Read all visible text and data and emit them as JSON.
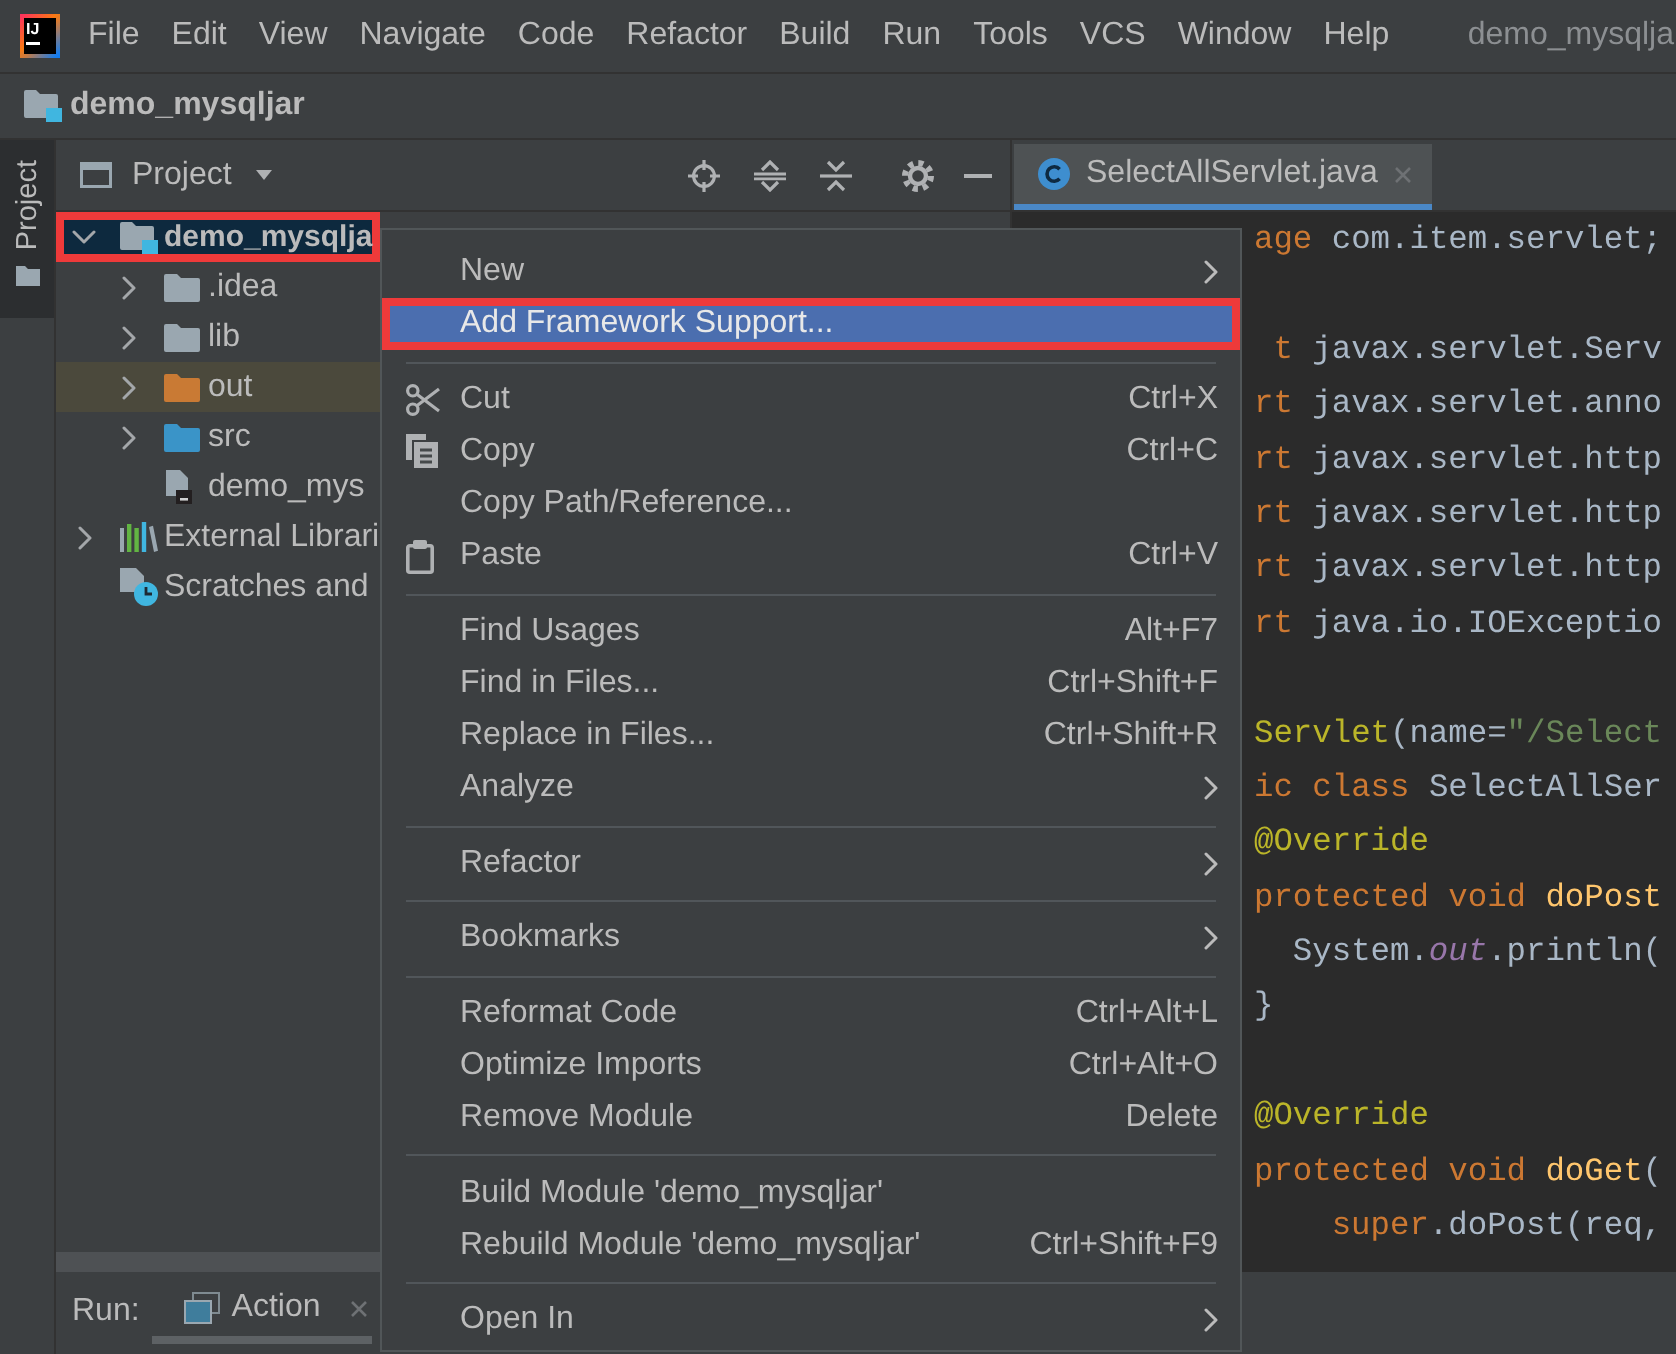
{
  "app_logo": {
    "text": "IJ"
  },
  "menu_bar": {
    "items": [
      {
        "label": "File"
      },
      {
        "label": "Edit"
      },
      {
        "label": "View"
      },
      {
        "label": "Navigate"
      },
      {
        "label": "Code"
      },
      {
        "label": "Refactor"
      },
      {
        "label": "Build"
      },
      {
        "label": "Run"
      },
      {
        "label": "Tools"
      },
      {
        "label": "VCS"
      },
      {
        "label": "Window"
      },
      {
        "label": "Help"
      }
    ],
    "window_title": "demo_mysqlja"
  },
  "navigation_bar": {
    "breadcrumbs": [
      {
        "label": "demo_mysqljar"
      }
    ]
  },
  "tool_strip": {
    "tabs": [
      {
        "label": "Project",
        "selected": true
      }
    ]
  },
  "project_panel": {
    "title": "Project",
    "tree": [
      {
        "label": "demo_mysqlja",
        "kind": "module",
        "selected": true,
        "highlighted": true,
        "expanded": true,
        "children": [
          {
            "label": ".idea",
            "kind": "folder",
            "selected": false,
            "highlighted": false,
            "expanded": false
          },
          {
            "label": "lib",
            "kind": "folder",
            "selected": false,
            "highlighted": false,
            "expanded": false
          },
          {
            "label": "out",
            "kind": "excluded",
            "selected": false,
            "highlighted": false,
            "expanded": false
          },
          {
            "label": "src",
            "kind": "source",
            "selected": false,
            "highlighted": false,
            "expanded": false
          },
          {
            "label": "demo_mys",
            "kind": "file",
            "selected": false,
            "highlighted": false
          }
        ]
      },
      {
        "label": "External Librari",
        "kind": "libraries",
        "selected": false,
        "highlighted": false,
        "expanded": false
      },
      {
        "label": "Scratches and",
        "kind": "scratches",
        "selected": false,
        "highlighted": false
      }
    ]
  },
  "editor": {
    "tabs": [
      {
        "label": "SelectAllServlet.java",
        "selected": true
      }
    ],
    "blocks": [
      {
        "lines": [
          {
            "segments": [
              {
                "kind": "keyword",
                "text": "age"
              },
              {
                "kind": "plain",
                "text": " com.item.servlet;"
              }
            ]
          }
        ]
      },
      {
        "lines": [
          {
            "segments": [
              {
                "kind": "keyword",
                "text": "t"
              },
              {
                "kind": "plain",
                "text": " javax.servlet.Serv"
              }
            ]
          },
          {
            "segments": [
              {
                "kind": "keyword",
                "text": "rt"
              },
              {
                "kind": "plain",
                "text": " javax.servlet.anno"
              }
            ]
          },
          {
            "segments": [
              {
                "kind": "keyword",
                "text": "rt"
              },
              {
                "kind": "plain",
                "text": " javax.servlet.http"
              }
            ]
          },
          {
            "segments": [
              {
                "kind": "keyword",
                "text": "rt"
              },
              {
                "kind": "plain",
                "text": " javax.servlet.http"
              }
            ]
          },
          {
            "segments": [
              {
                "kind": "keyword",
                "text": "rt"
              },
              {
                "kind": "plain",
                "text": " javax.servlet.http"
              }
            ]
          },
          {
            "segments": [
              {
                "kind": "keyword",
                "text": "rt"
              },
              {
                "kind": "plain",
                "text": " java.io.IOExceptio"
              }
            ]
          }
        ]
      },
      {
        "lines": [
          {
            "segments": [
              {
                "kind": "annotation",
                "text": "Servlet"
              },
              {
                "kind": "plain",
                "text": "(name="
              },
              {
                "kind": "string",
                "text": "\"/Select"
              }
            ]
          },
          {
            "segments": [
              {
                "kind": "keyword",
                "text": "ic class "
              },
              {
                "kind": "plain",
                "text": "SelectAllSer"
              }
            ]
          },
          {
            "segments": [
              {
                "kind": "annotation",
                "text": "@Override"
              }
            ]
          },
          {
            "segments": [
              {
                "kind": "keyword",
                "text": "protected void "
              },
              {
                "kind": "method",
                "text": "doPost"
              }
            ]
          },
          {
            "segments": [
              {
                "kind": "plain",
                "text": "System."
              },
              {
                "kind": "field",
                "text": "out"
              },
              {
                "kind": "plain",
                "text": ".println("
              }
            ]
          },
          {
            "segments": [
              {
                "kind": "plain",
                "text": "}"
              }
            ]
          }
        ]
      },
      {
        "lines": [
          {
            "segments": [
              {
                "kind": "annotation",
                "text": "@Override"
              }
            ]
          },
          {
            "segments": [
              {
                "kind": "keyword",
                "text": "protected void "
              },
              {
                "kind": "method",
                "text": "doGet"
              },
              {
                "kind": "plain",
                "text": "("
              }
            ]
          },
          {
            "segments": [
              {
                "kind": "keyword",
                "text": "super"
              },
              {
                "kind": "plain",
                "text": ".doPost(req,"
              }
            ]
          }
        ]
      }
    ]
  },
  "run_panel": {
    "label": "Run:",
    "tabs": [
      {
        "label": "Action",
        "selected": true
      }
    ]
  },
  "context_menu": {
    "groups": [
      {
        "items": [
          {
            "label": "New",
            "submenu": true,
            "selected": false,
            "highlighted": false
          },
          {
            "label": "Add Framework Support...",
            "submenu": false,
            "selected": true,
            "highlighted": true
          }
        ]
      },
      {
        "items": [
          {
            "label": "Cut",
            "shortcut": "Ctrl+X",
            "submenu": false,
            "selected": false,
            "highlighted": false
          },
          {
            "label": "Copy",
            "shortcut": "Ctrl+C",
            "submenu": false,
            "selected": false,
            "highlighted": false
          },
          {
            "label": "Copy Path/Reference...",
            "submenu": false,
            "selected": false,
            "highlighted": false
          },
          {
            "label": "Paste",
            "shortcut": "Ctrl+V",
            "submenu": false,
            "selected": false,
            "highlighted": false
          }
        ]
      },
      {
        "items": [
          {
            "label": "Find Usages",
            "shortcut": "Alt+F7",
            "submenu": false,
            "selected": false,
            "highlighted": false
          },
          {
            "label": "Find in Files...",
            "shortcut": "Ctrl+Shift+F",
            "submenu": false,
            "selected": false,
            "highlighted": false
          },
          {
            "label": "Replace in Files...",
            "shortcut": "Ctrl+Shift+R",
            "submenu": false,
            "selected": false,
            "highlighted": false
          },
          {
            "label": "Analyze",
            "submenu": true,
            "selected": false,
            "highlighted": false
          }
        ]
      },
      {
        "items": [
          {
            "label": "Refactor",
            "submenu": true,
            "selected": false,
            "highlighted": false
          }
        ]
      },
      {
        "items": [
          {
            "label": "Bookmarks",
            "submenu": true,
            "selected": false,
            "highlighted": false
          }
        ]
      },
      {
        "items": [
          {
            "label": "Reformat Code",
            "shortcut": "Ctrl+Alt+L",
            "submenu": false,
            "selected": false,
            "highlighted": false
          },
          {
            "label": "Optimize Imports",
            "shortcut": "Ctrl+Alt+O",
            "submenu": false,
            "selected": false,
            "highlighted": false
          },
          {
            "label": "Remove Module",
            "shortcut": "Delete",
            "submenu": false,
            "selected": false,
            "highlighted": false
          }
        ]
      },
      {
        "items": [
          {
            "label": "Build Module 'demo_mysqljar'",
            "submenu": false,
            "selected": false,
            "highlighted": false
          },
          {
            "label": "Rebuild Module 'demo_mysqljar'",
            "shortcut": "Ctrl+Shift+F9",
            "submenu": false,
            "selected": false,
            "highlighted": false
          }
        ]
      },
      {
        "items": [
          {
            "label": "Open In",
            "submenu": true,
            "selected": false,
            "highlighted": false
          }
        ]
      }
    ]
  }
}
